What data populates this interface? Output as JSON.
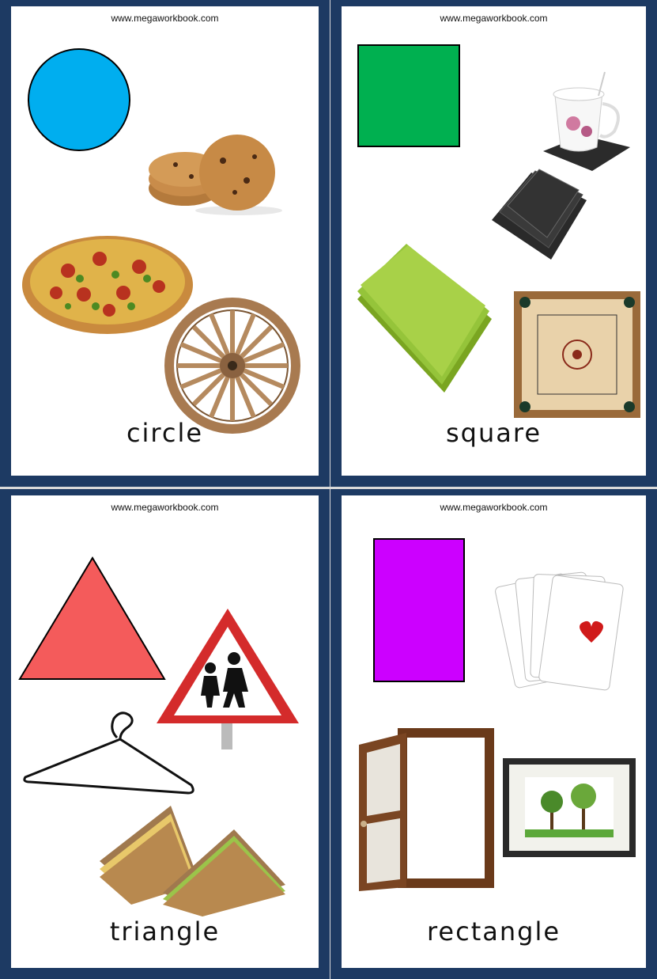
{
  "cards": [
    {
      "url": "www.megaworkbook.com",
      "word": "circle",
      "shape_color": "#00aeef",
      "examples": [
        "cookies-image",
        "pizza-image",
        "wagon-wheel-image"
      ]
    },
    {
      "url": "www.megaworkbook.com",
      "word": "square",
      "shape_color": "#00b050",
      "examples": [
        "teacup-image",
        "coasters-image",
        "napkins-image",
        "carrom-board-image"
      ]
    },
    {
      "url": "www.megaworkbook.com",
      "word": "triangle",
      "shape_color": "#f45b5b",
      "examples": [
        "warning-sign-image",
        "hanger-image",
        "sandwich-image"
      ]
    },
    {
      "url": "www.megaworkbook.com",
      "word": "rectangle",
      "shape_color": "#cc00ff",
      "examples": [
        "playing-cards-image",
        "door-image",
        "picture-frame-image"
      ]
    }
  ]
}
